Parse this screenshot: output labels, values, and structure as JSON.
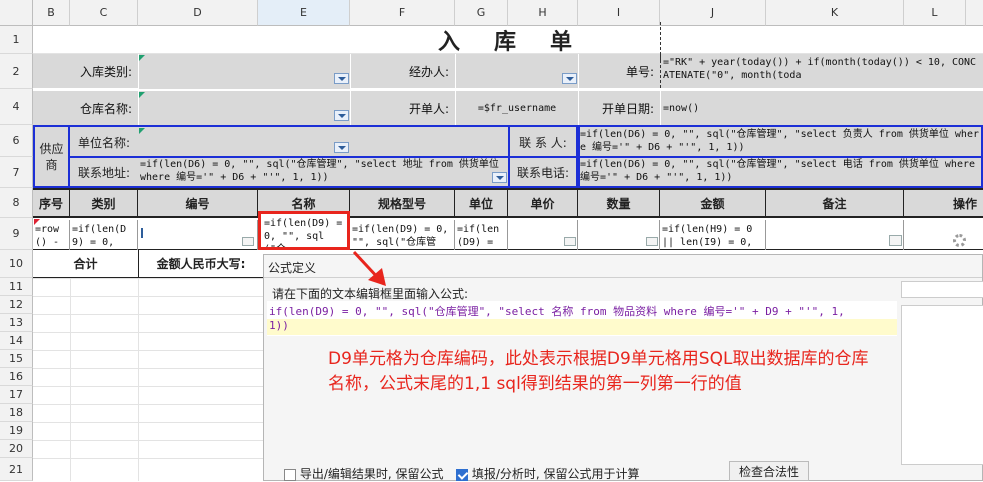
{
  "columns": [
    "B",
    "C",
    "D",
    "E",
    "F",
    "G",
    "H",
    "I",
    "J",
    "K",
    "L"
  ],
  "rows": [
    "1",
    "2",
    "4",
    "6",
    "7",
    "8",
    "9",
    "10",
    "11",
    "12",
    "13",
    "14",
    "15",
    "16",
    "17",
    "18",
    "19",
    "20",
    "21"
  ],
  "title": "入　库　单",
  "labels": {
    "inbound_type": "入库类别:",
    "handler": "经办人:",
    "doc_no": "单号:",
    "warehouse_name": "仓库名称:",
    "creator": "开单人:",
    "creator_value": "=$fr_username",
    "date": "开单日期:",
    "date_value": "=now()",
    "supplier": "供应商",
    "unit_name": "单位名称:",
    "contact_person": "联 系 人:",
    "contact_address": "联系地址:",
    "contact_phone": "联系电话:",
    "total": "合计",
    "amount_cn": "金额人民币大写:"
  },
  "formulas": {
    "doc_no": "=\"RK\" + year(today()) + if(month(today()) < 10, CONCATENATE(\"0\", month(toda",
    "contact_person": "=if(len(D6) = 0, \"\", sql(\"仓库管理\", \"select 负责人 from 供货单位 where 编号='\" + D6 + \"'\", 1, 1))",
    "contact_address": "=if(len(D6) = 0, \"\", sql(\"仓库管理\", \"select 地址 from 供货单位 where 编号='\" + D6 + \"'\", 1, 1))",
    "contact_phone": "=if(len(D6) = 0, \"\", sql(\"仓库管理\", \"select 电话 from 供货单位 where 编号='\" + D6 + \"'\", 1, 1))",
    "row9_seq": "=row() -",
    "row9_type": "=if(len(D9) = 0,",
    "row9_name": "=if(len(D9) = 0, \"\", sql(\"仓",
    "row9_spec": "=if(len(D9) = 0, \"\", sql(\"仓库管",
    "row9_unit": "=if(len(D9) = 0,",
    "row9_amount": "=if(len(H9) = 0 || len(I9) = 0, \""
  },
  "table_headers": [
    "序号",
    "类别",
    "编号",
    "名称",
    "规格型号",
    "单位",
    "单价",
    "数量",
    "金额",
    "备注",
    "操作"
  ],
  "dialog": {
    "title": "公式定义",
    "instruction": "请在下面的文本编辑框里面输入公式:",
    "formula_line1": "if(len(D9) = 0, \"\", sql(\"仓库管理\", \"select 名称 from 物品资料 where 编号='\" + D9 + \"'\", 1,",
    "formula_line2": "1))",
    "annotation": "D9单元格为仓库编码，此处表示根据D9单元格用SQL取出数据库的仓库名称，公式末尾的1,1 sql得到结果的第一列第一行的值",
    "checkbox1": "导出/编辑结果时, 保留公式",
    "checkbox2": "填报/分析时, 保留公式用于计算",
    "validate_button": "检查合法性",
    "checkbox1_checked": false,
    "checkbox2_checked": true
  },
  "colors": {
    "accent_red": "#e8251d",
    "border_blue": "#1c2fd6",
    "header_gray": "#d9d9d9",
    "annotation_red": "#e8251d"
  }
}
